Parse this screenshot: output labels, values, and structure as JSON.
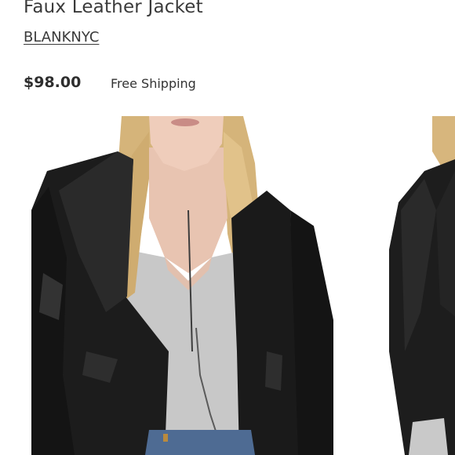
{
  "product": {
    "title": "Faux Leather Jacket",
    "brand": "BLANKNYC",
    "price": "$98.00",
    "shipping": "Free Shipping"
  },
  "carousel": {
    "images": [
      {
        "alt": "Faux Leather Jacket"
      },
      {
        "alt": "Faux Leather Jacket"
      }
    ]
  },
  "colors": {
    "text": "#3a3a3a",
    "jacket": "#1b1b1b",
    "tee": "#c9c9c9",
    "hair": "#d8b77c",
    "skin": "#eac7b5"
  }
}
